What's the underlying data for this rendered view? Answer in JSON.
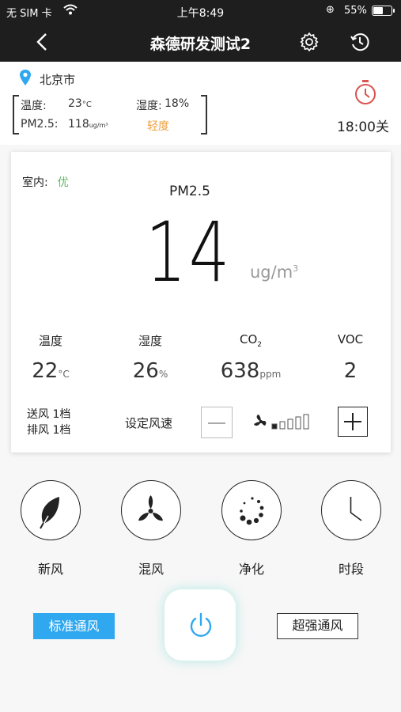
{
  "status_bar": {
    "carrier": "无 SIM 卡",
    "time": "上午8:49",
    "battery_pct": "55%",
    "battery_level": 0.55
  },
  "nav": {
    "title": "森德研发测试2",
    "icons": [
      "back-chevron-icon",
      "gear-icon",
      "history-icon"
    ]
  },
  "outdoor": {
    "city": "北京市",
    "temp_label": "温度:",
    "temp_value": "23",
    "temp_unit": "°C",
    "humidity_label": "湿度:",
    "humidity_value": "18%",
    "pm_label": "PM2.5:",
    "pm_value": "118",
    "pm_unit": "ug/m³",
    "air_level": "轻度"
  },
  "timer": {
    "text": "18:00关"
  },
  "indoor": {
    "label": "室内:",
    "quality": "优",
    "pm_label": "PM2.5",
    "pm_value": "14",
    "pm_unit": "ug/m",
    "pm_unit_sup": "3",
    "metrics": [
      {
        "label": "温度",
        "value": "22",
        "unit": "°C"
      },
      {
        "label": "湿度",
        "value": "26",
        "unit": "%"
      },
      {
        "label": "CO",
        "label_sub": "2",
        "value": "638",
        "unit": "ppm"
      },
      {
        "label": "VOC",
        "value": "2",
        "unit": ""
      }
    ],
    "supply_wind": "送风 1档",
    "exhaust_wind": "排风 1档",
    "set_speed_label": "设定风速",
    "fan_level": 1,
    "fan_levels_total": 5
  },
  "modes": [
    {
      "label": "新风",
      "icon": "leaf-icon"
    },
    {
      "label": "混风",
      "icon": "fan-blades-icon"
    },
    {
      "label": "净化",
      "icon": "dots-spinner-icon"
    },
    {
      "label": "时段",
      "icon": "clock-icon"
    }
  ],
  "bottom": {
    "standard_ventilation": "标准通风",
    "strong_ventilation": "超强通风",
    "accent_color": "#2fa8f0"
  }
}
